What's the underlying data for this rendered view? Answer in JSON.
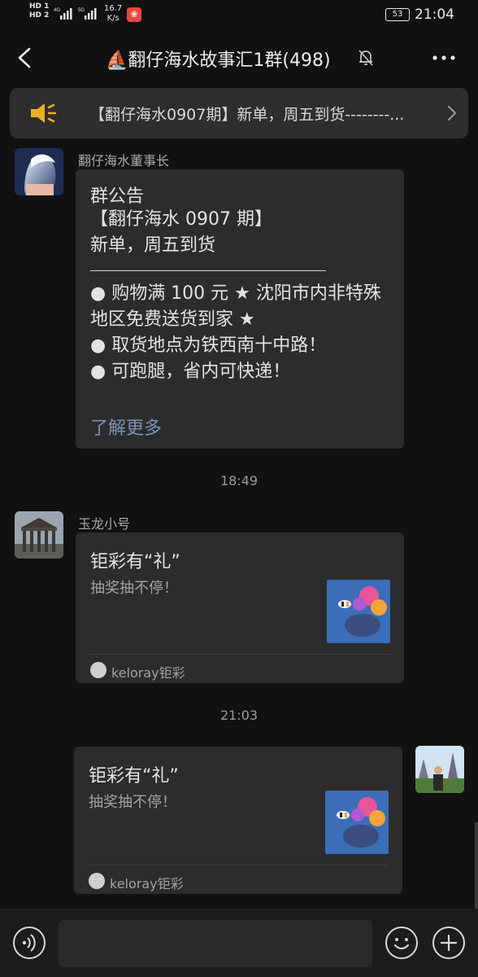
{
  "status_bar": {
    "hd_label_1": "HD 1",
    "hd_label_2": "HD 2",
    "net_1": "4G",
    "net_2": "5G",
    "speed_value": "16.7",
    "speed_unit": "K/s",
    "battery": "53",
    "time": "21:04"
  },
  "header": {
    "title": "⛵翻仔海水故事汇1群(498)"
  },
  "notice": {
    "text": "【翻仔海水0907期】新单，周五到货--------..."
  },
  "messages": [
    {
      "sender": "翻仔海水董事长",
      "type": "announcement",
      "title": "群公告",
      "lines": [
        "【翻仔海水 0907 期】",
        "新单，周五到货"
      ],
      "bullets": [
        "● 购物满 100 元 ★ 沈阳市内非特殊地区免费送货到家 ★",
        "● 取货地点为铁西南十中路！",
        "● 可跑腿，省内可快递！"
      ],
      "more": "了解更多"
    },
    {
      "time": "18:49",
      "sender": "玉龙小号",
      "type": "card",
      "title": "钜彩有“礼”",
      "desc": "抽奖抽不停！",
      "source": "keloray钜彩"
    },
    {
      "time": "21:03",
      "type": "card-self",
      "title": "钜彩有“礼”",
      "desc": "抽奖抽不停！",
      "source": "keloray钜彩"
    }
  ],
  "icons": {
    "back": "chevron-left-icon",
    "mute": "bell-off-icon",
    "more": "more-dots-icon",
    "speaker": "speaker-icon",
    "voice": "voice-icon",
    "emoji": "emoji-icon",
    "plus": "plus-icon"
  },
  "colors": {
    "background": "#111111",
    "bubble": "#2c2c2c",
    "link": "#7a93b6",
    "speaker": "#e8b21e"
  }
}
